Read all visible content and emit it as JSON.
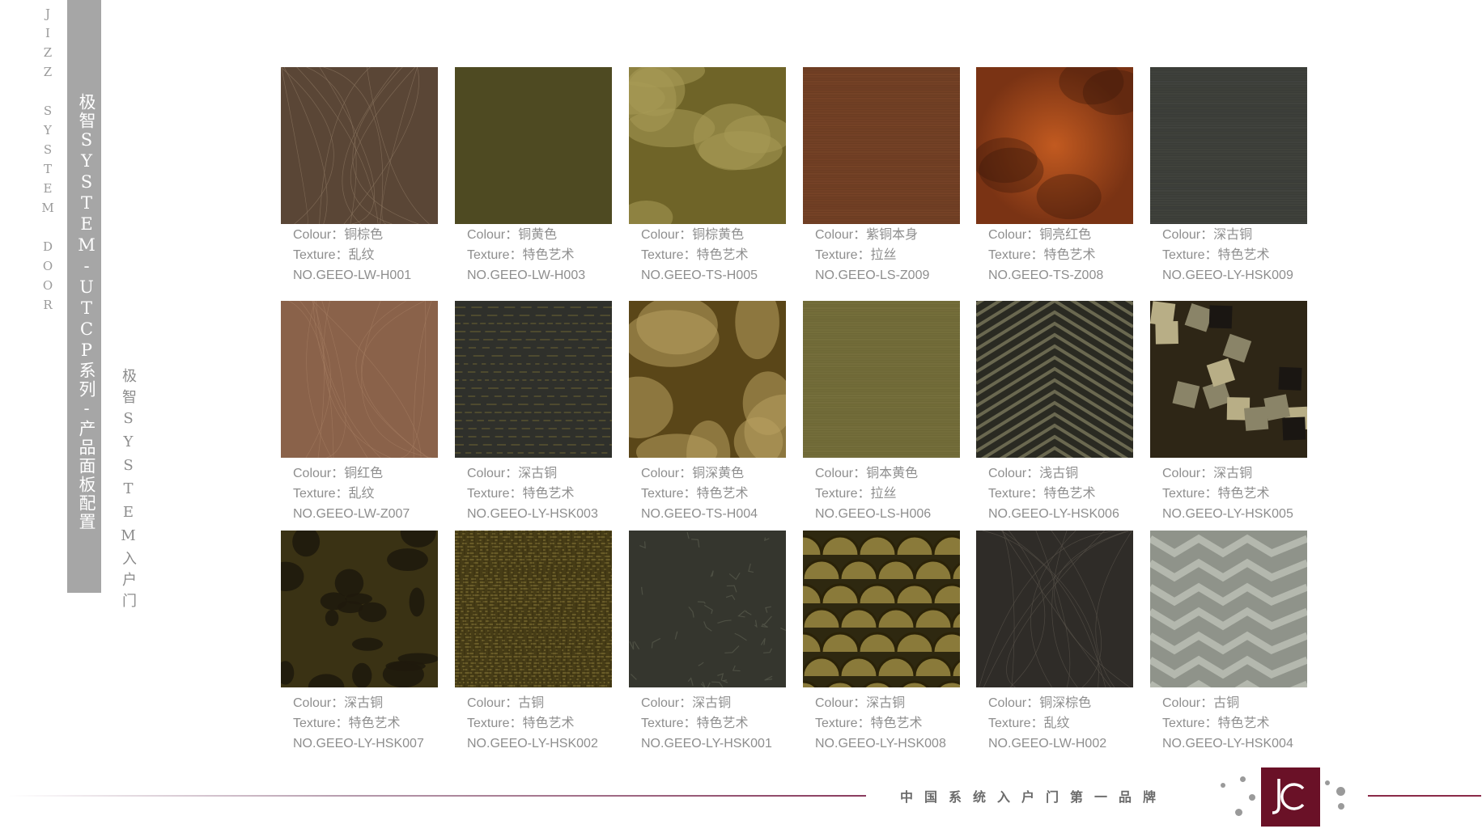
{
  "side": {
    "brand_vertical": "JIZZ SYSTEM DOOR",
    "series_title": "极智SYSTEM-UTCP系列-产品面板配置",
    "sub_title": "极智SYSTEM入户门"
  },
  "labels": {
    "colour": "Colour：",
    "texture": "Texture："
  },
  "swatches": [
    {
      "colour": "铜棕色",
      "texture": "乱纹",
      "code": "NO.GEEO-LW-H001",
      "base": "#5a4636",
      "pattern": "scratch",
      "accent": "#8a7560"
    },
    {
      "colour": "铜黄色",
      "texture": "特色艺术",
      "code": "NO.GEEO-LW-H003",
      "base": "#4e4a22",
      "pattern": "plain",
      "accent": "#5f5a2c"
    },
    {
      "colour": "铜棕黄色",
      "texture": "特色艺术",
      "code": "NO.GEEO-TS-H005",
      "base": "#6f6428",
      "pattern": "cloud",
      "accent": "#a89a55"
    },
    {
      "colour": "紫铜本身",
      "texture": "拉丝",
      "code": "NO.GEEO-LS-Z009",
      "base": "#6c3c22",
      "pattern": "brushed",
      "accent": "#8a5030"
    },
    {
      "colour": "铜亮红色",
      "texture": "特色艺术",
      "code": "NO.GEEO-TS-Z008",
      "base": "#7a3314",
      "pattern": "glow",
      "accent": "#c25a20"
    },
    {
      "colour": "深古铜",
      "texture": "特色艺术",
      "code": "NO.GEEO-LY-HSK009",
      "base": "#3a3c37",
      "pattern": "brushed",
      "accent": "#50524c"
    },
    {
      "colour": "铜红色",
      "texture": "乱纹",
      "code": "NO.GEEO-LW-Z007",
      "base": "#8a624a",
      "pattern": "scratch",
      "accent": "#a27a60"
    },
    {
      "colour": "深古铜",
      "texture": "特色艺术",
      "code": "NO.GEEO-LY-HSK003",
      "base": "#2f302b",
      "pattern": "lines",
      "accent": "#6e6434"
    },
    {
      "colour": "铜深黄色",
      "texture": "特色艺术",
      "code": "NO.GEEO-TS-H004",
      "base": "#5a4618",
      "pattern": "cloud",
      "accent": "#b8a060"
    },
    {
      "colour": "铜本黄色",
      "texture": "拉丝",
      "code": "NO.GEEO-LS-H006",
      "base": "#6e6836",
      "pattern": "brushed",
      "accent": "#857e48"
    },
    {
      "colour": "浅古铜",
      "texture": "特色艺术",
      "code": "NO.GEEO-LY-HSK006",
      "base": "#2a2a22",
      "pattern": "chevron",
      "accent": "#6a6850"
    },
    {
      "colour": "深古铜",
      "texture": "特色艺术",
      "code": "NO.GEEO-LY-HSK005",
      "base": "#2e2616",
      "pattern": "squares",
      "accent": "#b8ae86"
    },
    {
      "colour": "深古铜",
      "texture": "特色艺术",
      "code": "NO.GEEO-LY-HSK007",
      "base": "#3a3214",
      "pattern": "blots",
      "accent": "#1f1a0c"
    },
    {
      "colour": "古铜",
      "texture": "特色艺术",
      "code": "NO.GEEO-LY-HSK002",
      "base": "#463c16",
      "pattern": "weave",
      "accent": "#8a7a3a"
    },
    {
      "colour": "深古铜",
      "texture": "特色艺术",
      "code": "NO.GEEO-LY-HSK001",
      "base": "#35362e",
      "pattern": "crackle",
      "accent": "#4e5044"
    },
    {
      "colour": "深古铜",
      "texture": "特色艺术",
      "code": "NO.GEEO-LY-HSK008",
      "base": "#2e2810",
      "pattern": "scales",
      "accent": "#8a7a3a"
    },
    {
      "colour": "铜深棕色",
      "texture": "乱纹",
      "code": "NO.GEEO-LW-H002",
      "base": "#2f2c28",
      "pattern": "scratch",
      "accent": "#5a544c"
    },
    {
      "colour": "古铜",
      "texture": "特色艺术",
      "code": "NO.GEEO-LY-HSK004",
      "base": "#8f938a",
      "pattern": "zigzag",
      "accent": "#b4b8ae"
    }
  ],
  "footer": {
    "tagline": "中国系统入户门第一品牌"
  },
  "logo": {
    "mark": "JC"
  }
}
